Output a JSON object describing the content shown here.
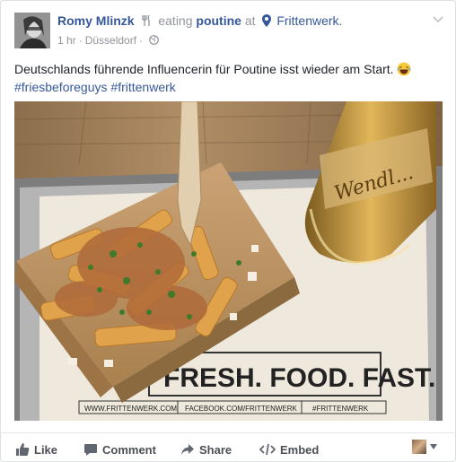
{
  "post": {
    "author": "Romy Mlinzk",
    "activity": "eating",
    "object": "poutine",
    "at_word": "at",
    "place": "Frittenwerk.",
    "time": "1 hr",
    "separator": "·",
    "location": "Düsseldorf",
    "text": "Deutschlands führende Influencerin für Poutine isst wieder am Start.",
    "hashtags": [
      "#friesbeforeguys",
      "#frittenwerk"
    ],
    "emoji": "laughing-crying-emoji"
  },
  "photo": {
    "tray_slogan": "FRESH. FOOD. FAST.",
    "tray_small": "FRITTENWERK",
    "tray_links": [
      "WWW.FRITTENWERK.COM",
      "FACEBOOK.COM/FRITTENWERK",
      "#FRITTENWERK"
    ],
    "bottle_label": "Wendl..."
  },
  "actions": {
    "like": "Like",
    "comment": "Comment",
    "share": "Share",
    "embed": "Embed"
  },
  "colors": {
    "link": "#365899",
    "meta": "#90949c",
    "action": "#4b4f56"
  }
}
